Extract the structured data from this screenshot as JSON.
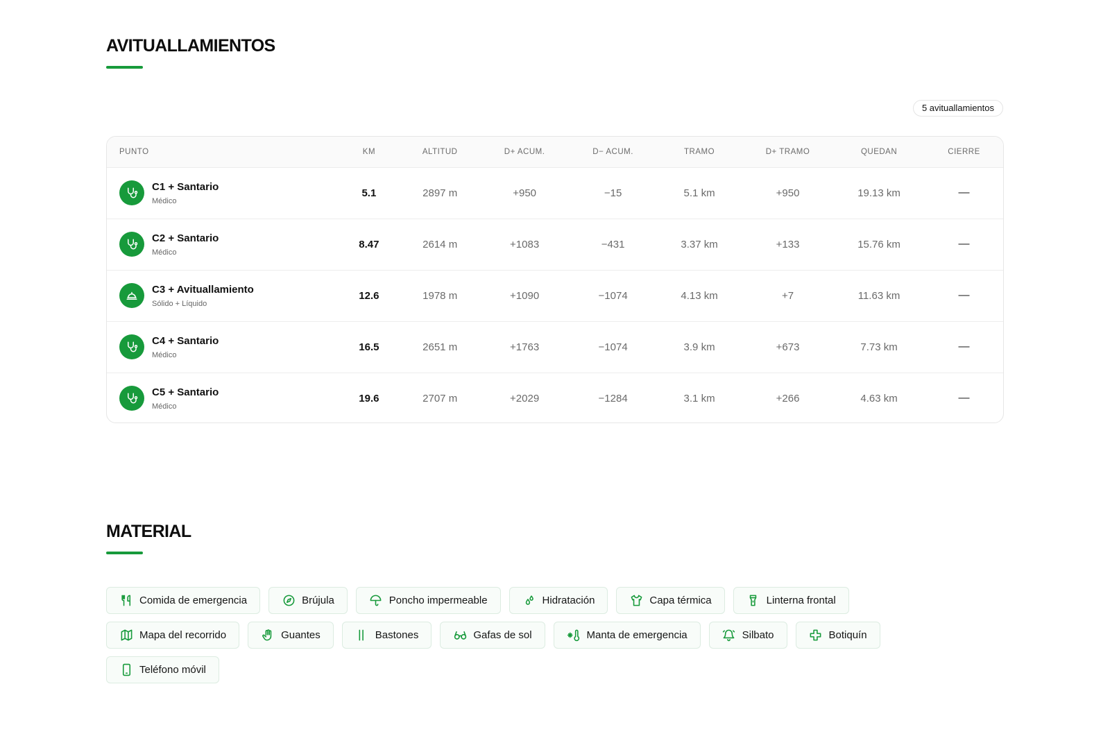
{
  "avituallamientos": {
    "title": "AVITUALLAMIENTOS",
    "count_label": "5 avituallamientos",
    "columns": [
      "PUNTO",
      "KM",
      "ALTITUD",
      "D+ ACUM.",
      "D− ACUM.",
      "TRAMO",
      "D+ TRAMO",
      "QUEDAN",
      "CIERRE"
    ],
    "rows": [
      {
        "name": "C1 + Santario",
        "type": "Médico",
        "icon": "stethoscope-icon",
        "km": "5.1",
        "altitud": "2897 m",
        "d_plus": "+950",
        "d_minus": "−15",
        "tramo": "5.1 km",
        "d_plus_tramo": "+950",
        "quedan": "19.13 km",
        "cierre": "—"
      },
      {
        "name": "C2 + Santario",
        "type": "Médico",
        "icon": "stethoscope-icon",
        "km": "8.47",
        "altitud": "2614 m",
        "d_plus": "+1083",
        "d_minus": "−431",
        "tramo": "3.37 km",
        "d_plus_tramo": "+133",
        "quedan": "15.76 km",
        "cierre": "—"
      },
      {
        "name": "C3 + Avituallamiento",
        "type": "Sólido + Líquido",
        "icon": "food-tray-icon",
        "km": "12.6",
        "altitud": "1978 m",
        "d_plus": "+1090",
        "d_minus": "−1074",
        "tramo": "4.13 km",
        "d_plus_tramo": "+7",
        "quedan": "11.63 km",
        "cierre": "—"
      },
      {
        "name": "C4 + Santario",
        "type": "Médico",
        "icon": "stethoscope-icon",
        "km": "16.5",
        "altitud": "2651 m",
        "d_plus": "+1763",
        "d_minus": "−1074",
        "tramo": "3.9 km",
        "d_plus_tramo": "+673",
        "quedan": "7.73 km",
        "cierre": "—"
      },
      {
        "name": "C5 + Santario",
        "type": "Médico",
        "icon": "stethoscope-icon",
        "km": "19.6",
        "altitud": "2707 m",
        "d_plus": "+2029",
        "d_minus": "−1284",
        "tramo": "3.1 km",
        "d_plus_tramo": "+266",
        "quedan": "4.63 km",
        "cierre": "—"
      }
    ]
  },
  "material": {
    "title": "MATERIAL",
    "items": [
      {
        "label": "Comida de emergencia",
        "icon": "utensils-icon"
      },
      {
        "label": "Brújula",
        "icon": "compass-icon"
      },
      {
        "label": "Poncho impermeable",
        "icon": "umbrella-icon"
      },
      {
        "label": "Hidratación",
        "icon": "droplets-icon"
      },
      {
        "label": "Capa térmica",
        "icon": "shirt-icon"
      },
      {
        "label": "Linterna frontal",
        "icon": "flashlight-icon"
      },
      {
        "label": "Mapa del recorrido",
        "icon": "map-icon"
      },
      {
        "label": "Guantes",
        "icon": "hand-icon"
      },
      {
        "label": "Bastones",
        "icon": "poles-icon"
      },
      {
        "label": "Gafas de sol",
        "icon": "glasses-icon"
      },
      {
        "label": "Manta de emergencia",
        "icon": "thermometer-snow-icon"
      },
      {
        "label": "Silbato",
        "icon": "bell-icon"
      },
      {
        "label": "Botiquín",
        "icon": "cross-icon"
      },
      {
        "label": "Teléfono móvil",
        "icon": "smartphone-icon"
      }
    ]
  },
  "colors": {
    "accent": "#179a3b",
    "chip_border": "#dcece1",
    "chip_bg": "#f8fcf9"
  }
}
